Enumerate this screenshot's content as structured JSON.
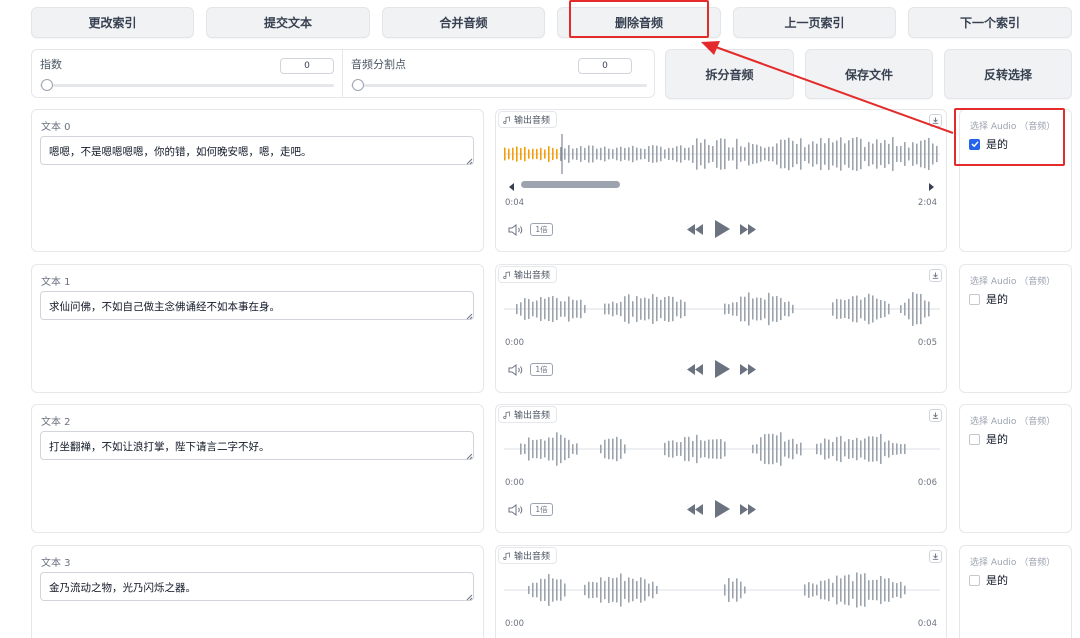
{
  "toolbar": {
    "change_index": "更改索引",
    "submit_text": "提交文本",
    "merge_audio": "合并音频",
    "delete_audio": "删除音频",
    "prev_page_index": "上一页索引",
    "next_index": "下一个索引",
    "split_audio": "拆分音频",
    "save_file": "保存文件",
    "invert_selection": "反转选择"
  },
  "sliders": {
    "exponent": {
      "label": "指数",
      "value": "0",
      "level": 0
    },
    "split_point": {
      "label": "音频分割点",
      "value": "0",
      "level": 0
    }
  },
  "rows": [
    {
      "text_label": "文本 0",
      "text": "嗯嗯，不是嗯嗯嗯嗯，你的错，如何晚安嗯，嗯，走吧。",
      "audio_label": "输出音频",
      "time_current": "0:04",
      "time_total": "2:04",
      "speed": "1倍",
      "select_label": "选择 Audio （音频）",
      "checkbox_label": "是的",
      "checked": true
    },
    {
      "text_label": "文本 1",
      "text": "求仙问佛，不如自己做主念佛诵经不如本事在身。",
      "audio_label": "输出音频",
      "time_current": "0:00",
      "time_total": "0:05",
      "speed": "1倍",
      "select_label": "选择 Audio （音频）",
      "checkbox_label": "是的",
      "checked": false
    },
    {
      "text_label": "文本 2",
      "text": "打坐翻禅，不如让浪打掌，陛下请言二字不好。",
      "audio_label": "输出音频",
      "time_current": "0:00",
      "time_total": "0:06",
      "speed": "1倍",
      "select_label": "选择 Audio （音频）",
      "checkbox_label": "是的",
      "checked": false
    },
    {
      "text_label": "文本 3",
      "text": "金乃流动之物，光乃闪烁之器。",
      "audio_label": "输出音频",
      "time_current": "0:00",
      "time_total": "0:04",
      "select_label": "选择 Audio （音频）",
      "checkbox_label": "是的",
      "checked": false
    }
  ],
  "colors": {
    "accent_red": "#e32b2b",
    "waveform_played": "#f59e0b",
    "waveform": "#9ca3af",
    "checkbox_checked": "#2563eb"
  },
  "icons": {
    "music": "music-note-icon",
    "download": "download-icon",
    "volume": "volume-icon",
    "rewind": "rewind-icon",
    "play": "play-icon",
    "forward": "fast-forward-icon"
  }
}
